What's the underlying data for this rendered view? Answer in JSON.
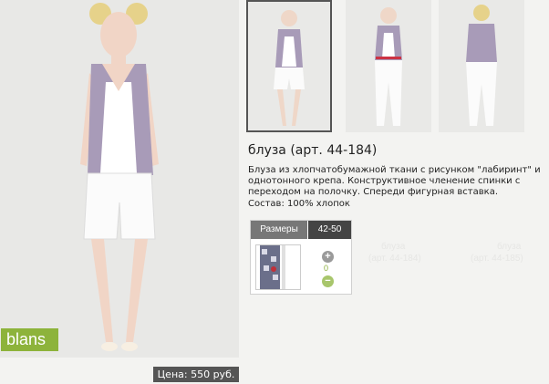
{
  "product": {
    "title": "блуза (арт. 44-184)",
    "description": "Блуза из хлопчатобумажной ткани с рисунком \"лабиринт\" и однотонного крепа. Конструктивное членение спинки с переходом на полочку. Спереди фигурная вставка.",
    "composition": "Состав: 100% хлопок",
    "price": "Цена: 550 руб.",
    "brand": "blans"
  },
  "sizes": {
    "label": "Размеры",
    "size": "42-50",
    "quantity": "0",
    "plus": "+",
    "minus": "−"
  },
  "background_texts": [
    "блуза",
    "(арт. 44-184)",
    "блуза",
    "(арт. 44-185)"
  ],
  "colors": {
    "brand_green": "#8db33b",
    "dark_header": "#444444",
    "price_bg": "#555555"
  }
}
